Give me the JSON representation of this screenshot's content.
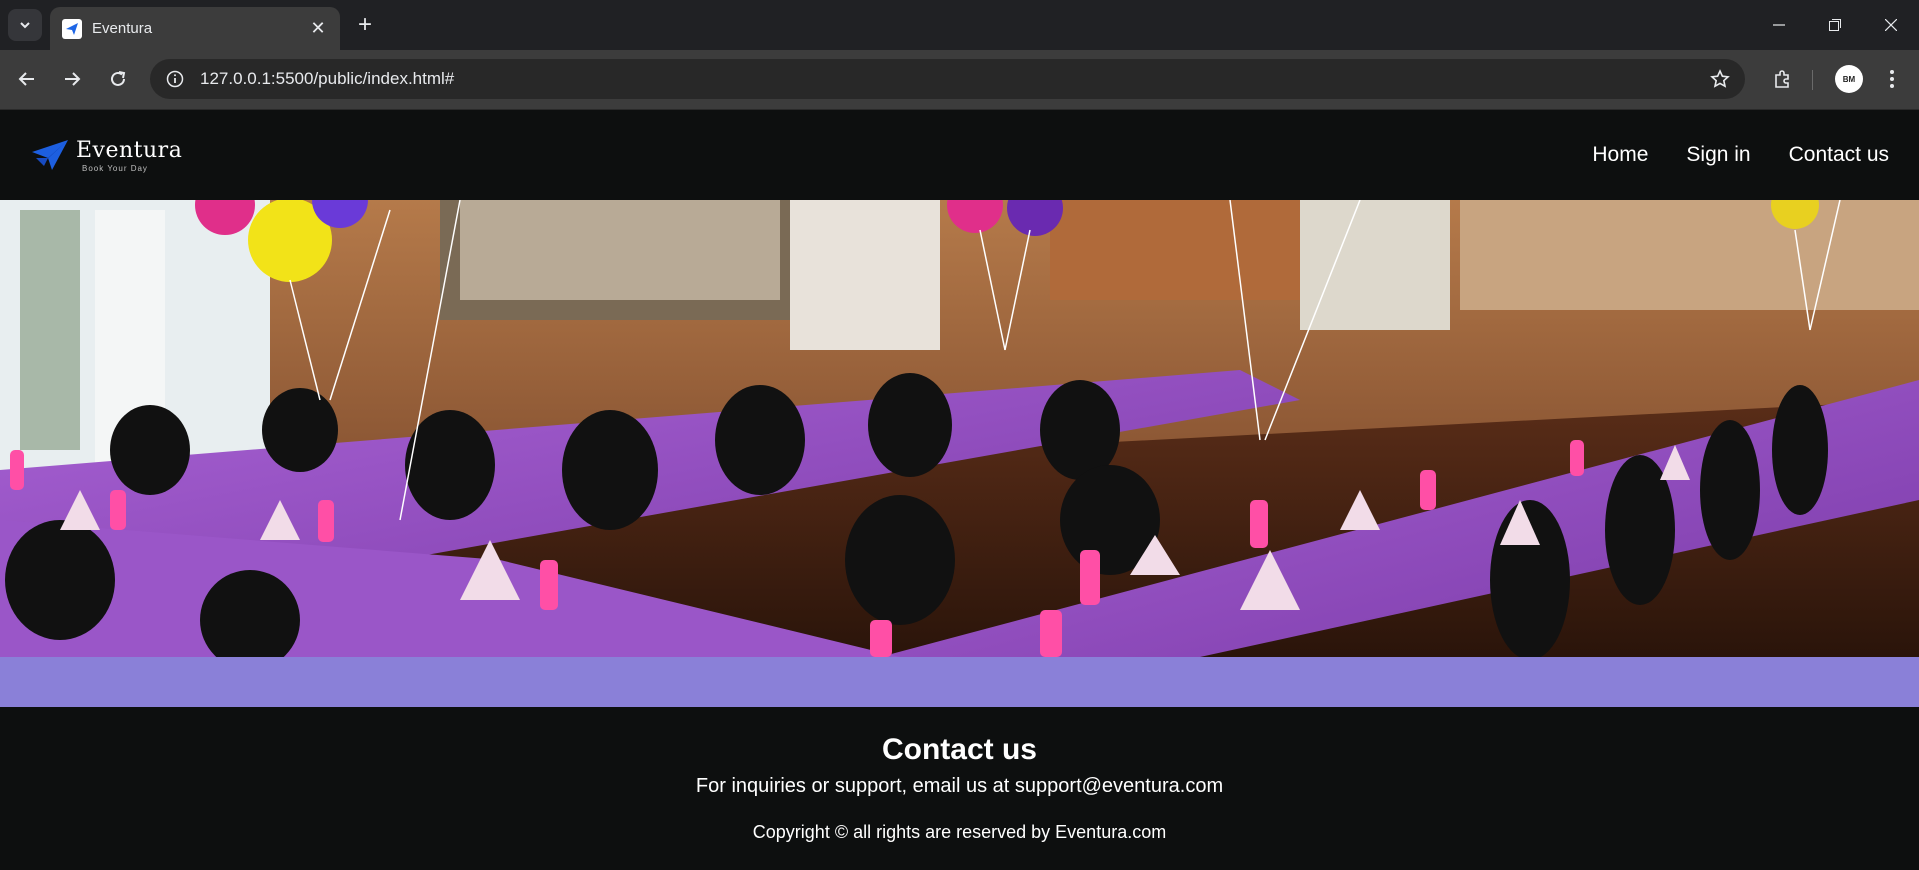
{
  "browser": {
    "tab_title": "Eventura",
    "url": "127.0.0.1:5500/public/index.html#",
    "avatar_initials": "BM",
    "icons": [
      "tab-search-icon",
      "close-icon",
      "plus-icon",
      "minimize-icon",
      "restore-icon",
      "window-close-icon",
      "back-arrow-icon",
      "forward-arrow-icon",
      "reload-icon",
      "site-info-icon",
      "bookmark-star-icon",
      "extensions-icon",
      "kebab-menu-icon"
    ]
  },
  "site": {
    "logo_name": "Eventura",
    "logo_tagline": "Book Your Day",
    "nav": [
      "Home",
      "Sign in",
      "Contact us"
    ],
    "colors": {
      "band": "#8a80d8",
      "background": "#0d0f0f",
      "tablecloth": "#9a56c8"
    }
  },
  "footer": {
    "heading": "Contact us",
    "contact_line": "For inquiries or support, email us at support@eventura.com",
    "copyright": "Copyright © all rights are reserved by Eventura.com"
  }
}
